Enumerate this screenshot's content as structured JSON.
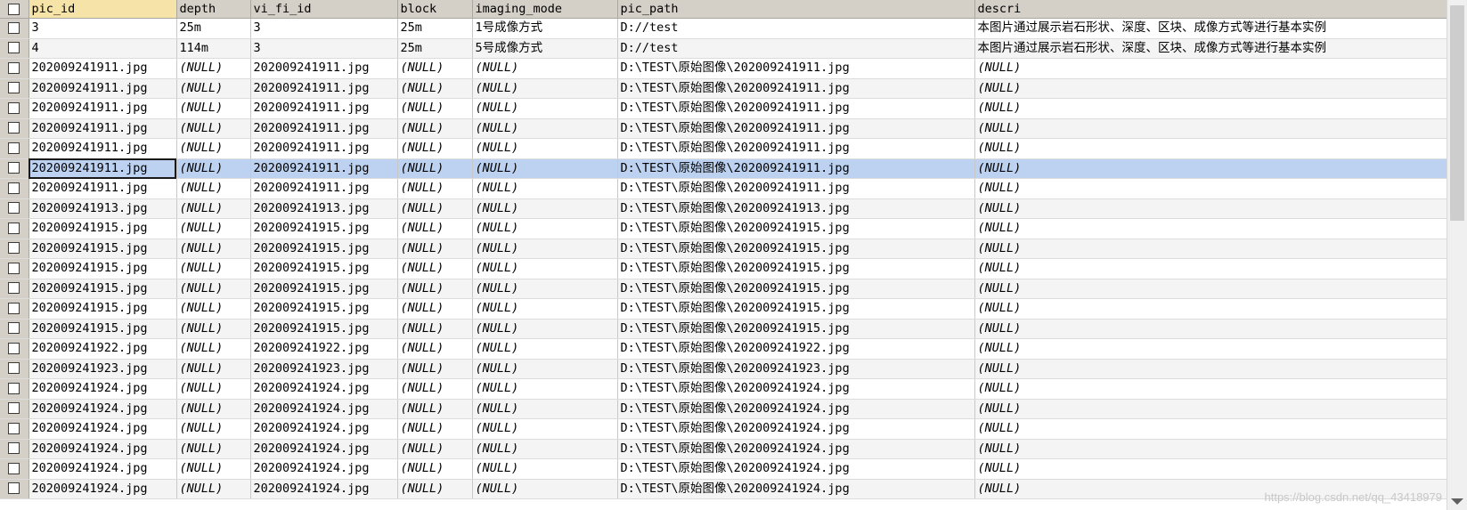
{
  "columns": [
    "pic_id",
    "depth",
    "vi_fi_id",
    "block",
    "imaging_mode",
    "pic_path",
    "descri"
  ],
  "rows": [
    [
      "3",
      "25m",
      "3",
      "25m",
      "1号成像方式",
      "D://test",
      "本图片通过展示岩石形状、深度、区块、成像方式等进行基本实例"
    ],
    [
      "4",
      "114m",
      "3",
      "25m",
      "5号成像方式",
      "D://test",
      "本图片通过展示岩石形状、深度、区块、成像方式等进行基本实例"
    ],
    [
      "202009241911.jpg",
      "(NULL)",
      "202009241911.jpg",
      "(NULL)",
      "(NULL)",
      "D:\\TEST\\原始图像\\202009241911.jpg",
      "(NULL)"
    ],
    [
      "202009241911.jpg",
      "(NULL)",
      "202009241911.jpg",
      "(NULL)",
      "(NULL)",
      "D:\\TEST\\原始图像\\202009241911.jpg",
      "(NULL)"
    ],
    [
      "202009241911.jpg",
      "(NULL)",
      "202009241911.jpg",
      "(NULL)",
      "(NULL)",
      "D:\\TEST\\原始图像\\202009241911.jpg",
      "(NULL)"
    ],
    [
      "202009241911.jpg",
      "(NULL)",
      "202009241911.jpg",
      "(NULL)",
      "(NULL)",
      "D:\\TEST\\原始图像\\202009241911.jpg",
      "(NULL)"
    ],
    [
      "202009241911.jpg",
      "(NULL)",
      "202009241911.jpg",
      "(NULL)",
      "(NULL)",
      "D:\\TEST\\原始图像\\202009241911.jpg",
      "(NULL)"
    ],
    [
      "202009241911.jpg",
      "(NULL)",
      "202009241911.jpg",
      "(NULL)",
      "(NULL)",
      "D:\\TEST\\原始图像\\202009241911.jpg",
      "(NULL)"
    ],
    [
      "202009241911.jpg",
      "(NULL)",
      "202009241911.jpg",
      "(NULL)",
      "(NULL)",
      "D:\\TEST\\原始图像\\202009241911.jpg",
      "(NULL)"
    ],
    [
      "202009241913.jpg",
      "(NULL)",
      "202009241913.jpg",
      "(NULL)",
      "(NULL)",
      "D:\\TEST\\原始图像\\202009241913.jpg",
      "(NULL)"
    ],
    [
      "202009241915.jpg",
      "(NULL)",
      "202009241915.jpg",
      "(NULL)",
      "(NULL)",
      "D:\\TEST\\原始图像\\202009241915.jpg",
      "(NULL)"
    ],
    [
      "202009241915.jpg",
      "(NULL)",
      "202009241915.jpg",
      "(NULL)",
      "(NULL)",
      "D:\\TEST\\原始图像\\202009241915.jpg",
      "(NULL)"
    ],
    [
      "202009241915.jpg",
      "(NULL)",
      "202009241915.jpg",
      "(NULL)",
      "(NULL)",
      "D:\\TEST\\原始图像\\202009241915.jpg",
      "(NULL)"
    ],
    [
      "202009241915.jpg",
      "(NULL)",
      "202009241915.jpg",
      "(NULL)",
      "(NULL)",
      "D:\\TEST\\原始图像\\202009241915.jpg",
      "(NULL)"
    ],
    [
      "202009241915.jpg",
      "(NULL)",
      "202009241915.jpg",
      "(NULL)",
      "(NULL)",
      "D:\\TEST\\原始图像\\202009241915.jpg",
      "(NULL)"
    ],
    [
      "202009241915.jpg",
      "(NULL)",
      "202009241915.jpg",
      "(NULL)",
      "(NULL)",
      "D:\\TEST\\原始图像\\202009241915.jpg",
      "(NULL)"
    ],
    [
      "202009241922.jpg",
      "(NULL)",
      "202009241922.jpg",
      "(NULL)",
      "(NULL)",
      "D:\\TEST\\原始图像\\202009241922.jpg",
      "(NULL)"
    ],
    [
      "202009241923.jpg",
      "(NULL)",
      "202009241923.jpg",
      "(NULL)",
      "(NULL)",
      "D:\\TEST\\原始图像\\202009241923.jpg",
      "(NULL)"
    ],
    [
      "202009241924.jpg",
      "(NULL)",
      "202009241924.jpg",
      "(NULL)",
      "(NULL)",
      "D:\\TEST\\原始图像\\202009241924.jpg",
      "(NULL)"
    ],
    [
      "202009241924.jpg",
      "(NULL)",
      "202009241924.jpg",
      "(NULL)",
      "(NULL)",
      "D:\\TEST\\原始图像\\202009241924.jpg",
      "(NULL)"
    ],
    [
      "202009241924.jpg",
      "(NULL)",
      "202009241924.jpg",
      "(NULL)",
      "(NULL)",
      "D:\\TEST\\原始图像\\202009241924.jpg",
      "(NULL)"
    ],
    [
      "202009241924.jpg",
      "(NULL)",
      "202009241924.jpg",
      "(NULL)",
      "(NULL)",
      "D:\\TEST\\原始图像\\202009241924.jpg",
      "(NULL)"
    ],
    [
      "202009241924.jpg",
      "(NULL)",
      "202009241924.jpg",
      "(NULL)",
      "(NULL)",
      "D:\\TEST\\原始图像\\202009241924.jpg",
      "(NULL)"
    ],
    [
      "202009241924.jpg",
      "(NULL)",
      "202009241924.jpg",
      "(NULL)",
      "(NULL)",
      "D:\\TEST\\原始图像\\202009241924.jpg",
      "(NULL)"
    ]
  ],
  "selected_row_index": 7,
  "watermark": "https://blog.csdn.net/qq_43418979"
}
